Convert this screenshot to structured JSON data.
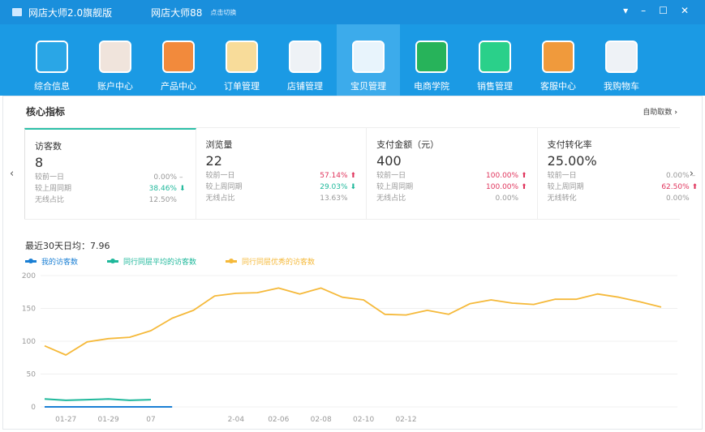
{
  "titlebar": {
    "app_title": "网店大师2.0旗舰版",
    "user": "网店大师88",
    "switch": "点击切换",
    "controls": [
      "▾",
      "–",
      "☐",
      "✕"
    ]
  },
  "toolbar": [
    {
      "label": "综合信息",
      "icon": "monitor-search-icon",
      "color": "#2aa6e6"
    },
    {
      "label": "账户中心",
      "icon": "user-avatar-icon",
      "color": "#f0e4dc"
    },
    {
      "label": "产品中心",
      "icon": "product-grid-icon",
      "color": "#f28a3c"
    },
    {
      "label": "订单管理",
      "icon": "order-book-icon",
      "color": "#f8dc9a"
    },
    {
      "label": "店铺管理",
      "icon": "store-icon",
      "color": "#eef2f6"
    },
    {
      "label": "宝贝管理",
      "icon": "toolbox-wrench-icon",
      "color": "#e8f4fc"
    },
    {
      "label": "电商学院",
      "icon": "academy-person-icon",
      "color": "#27b35a"
    },
    {
      "label": "销售管理",
      "icon": "shopping-bag-icon",
      "color": "#2ad08a"
    },
    {
      "label": "客服中心",
      "icon": "help-book-icon",
      "color": "#f09a3c"
    },
    {
      "label": "我购物车",
      "icon": "shopping-cart-icon",
      "color": "#eef2f6"
    }
  ],
  "active_tool": 5,
  "panel": {
    "title": "核心指标",
    "self_fetch": "自助取数",
    "prev": "‹",
    "next": "›"
  },
  "cards": [
    {
      "name": "访客数",
      "value": "8",
      "rows": [
        {
          "label": "较前一日",
          "value": "0.00%",
          "trend": "flat"
        },
        {
          "label": "较上周同期",
          "value": "38.46%",
          "trend": "down"
        },
        {
          "label": "无线占比",
          "value": "12.50%",
          "trend": ""
        }
      ]
    },
    {
      "name": "浏览量",
      "value": "22",
      "rows": [
        {
          "label": "较前一日",
          "value": "57.14%",
          "trend": "up"
        },
        {
          "label": "较上周同期",
          "value": "29.03%",
          "trend": "down"
        },
        {
          "label": "无线占比",
          "value": "13.63%",
          "trend": ""
        }
      ]
    },
    {
      "name": "支付金额（元）",
      "value": "400",
      "rows": [
        {
          "label": "较前一日",
          "value": "100.00%",
          "trend": "up"
        },
        {
          "label": "较上周同期",
          "value": "100.00%",
          "trend": "up"
        },
        {
          "label": "无线占比",
          "value": "0.00%",
          "trend": ""
        }
      ]
    },
    {
      "name": "支付转化率",
      "value": "25.00%",
      "rows": [
        {
          "label": "较前一日",
          "value": "0.00%",
          "trend": "flat"
        },
        {
          "label": "较上周同期",
          "value": "62.50%",
          "trend": "up"
        },
        {
          "label": "无线转化",
          "value": "0.00%",
          "trend": ""
        }
      ]
    }
  ],
  "chart_data": {
    "type": "line",
    "summary": "最近30天日均：7.96",
    "ylim": [
      0,
      200
    ],
    "yticks": [
      0,
      50,
      100,
      150,
      200
    ],
    "xticks": [
      {
        "x": 1,
        "label": "01-27"
      },
      {
        "x": 3,
        "label": "01-29"
      },
      {
        "x": 5,
        "label": "07"
      },
      {
        "x": 9,
        "label": "2-04"
      },
      {
        "x": 11,
        "label": "02-06"
      },
      {
        "x": 13,
        "label": "02-08"
      },
      {
        "x": 15,
        "label": "02-10"
      },
      {
        "x": 17,
        "label": "02-12"
      }
    ],
    "series": [
      {
        "name": "我的访客数",
        "color": "#1a7fd4",
        "x": [
          0,
          1,
          2,
          3,
          4,
          5,
          6
        ],
        "values": [
          0,
          0,
          0,
          0,
          0,
          0,
          0
        ]
      },
      {
        "name": "同行同层平均的访客数",
        "color": "#1fb89b",
        "x": [
          0,
          1,
          2,
          3,
          4,
          5
        ],
        "values": [
          12,
          10,
          11,
          12,
          10,
          11
        ]
      },
      {
        "name": "同行同层优秀的访客数",
        "color": "#f5b93a",
        "x": [
          0,
          1,
          2,
          3,
          4,
          5,
          6,
          7,
          8,
          9,
          10,
          11,
          12,
          13,
          14,
          15,
          16,
          17,
          18,
          19,
          20,
          21,
          22,
          23,
          24,
          25,
          26,
          27,
          28,
          29
        ],
        "values": [
          93,
          79,
          99,
          104,
          106,
          116,
          135,
          147,
          169,
          173,
          174,
          181,
          172,
          181,
          167,
          163,
          141,
          140,
          147,
          141,
          157,
          163,
          158,
          156,
          164,
          164,
          172,
          167,
          160,
          152
        ]
      }
    ]
  }
}
